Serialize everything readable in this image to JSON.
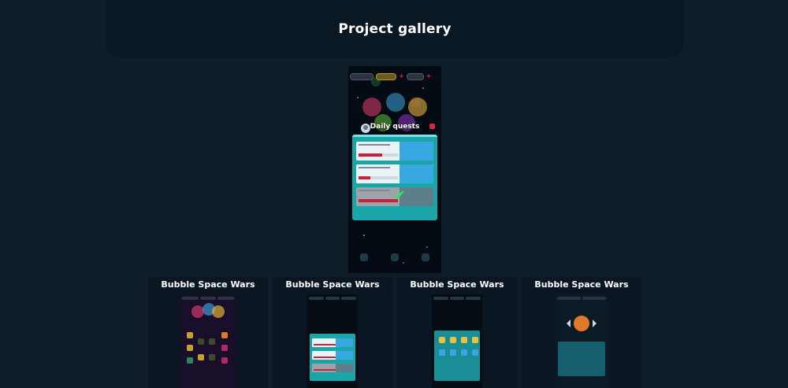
{
  "page": {
    "title": "Project gallery"
  },
  "featured": {
    "screen_title": "Daily quests",
    "icons": {
      "check": "checkmark-icon",
      "close": "close-icon"
    }
  },
  "gallery": {
    "cards": [
      {
        "title": "Bubble Space Wars"
      },
      {
        "title": "Bubble Space Wars"
      },
      {
        "title": "Bubble Space Wars"
      },
      {
        "title": "Bubble Space Wars"
      }
    ]
  },
  "colors": {
    "background": "#0f1d28",
    "header": "#0a1823",
    "panel_teal": "#1aa6a8",
    "reward_blue": "#38a8e0",
    "accent_red": "#d2283a",
    "check_green": "#2ee85a"
  }
}
